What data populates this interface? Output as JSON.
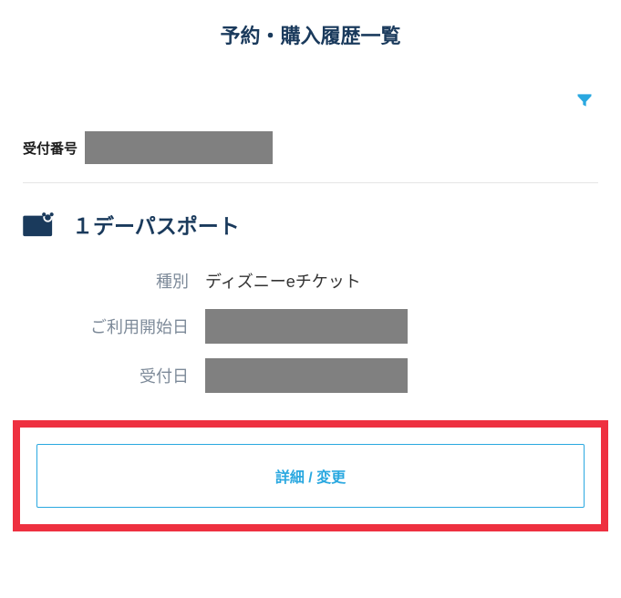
{
  "page_title": "予約・購入履歴一覧",
  "receipt": {
    "label": "受付番号",
    "value": ""
  },
  "product": {
    "title": "１デーパスポート",
    "rows": [
      {
        "label": "種別",
        "value": "ディズニーeチケット",
        "redacted": false
      },
      {
        "label": "ご利用開始日",
        "value": "",
        "redacted": true
      },
      {
        "label": "受付日",
        "value": "",
        "redacted": true
      }
    ]
  },
  "action_button": {
    "label": "詳細 / 変更"
  }
}
